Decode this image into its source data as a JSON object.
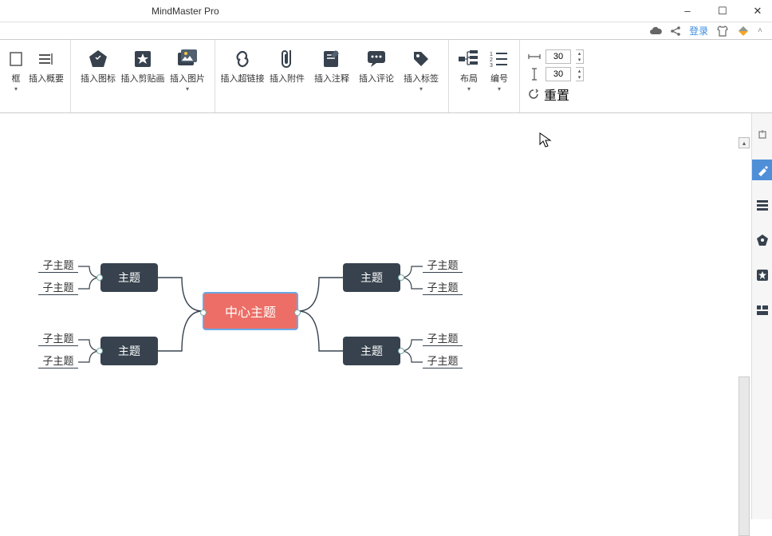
{
  "app_title": "MindMaster Pro",
  "window_controls": {
    "min": "–",
    "max": "☐",
    "close": "✕"
  },
  "secondary_bar": {
    "login_label": "登录",
    "icons": {
      "cloud": "cloud-icon",
      "share": "share-icon",
      "tshirt": "tshirt-icon",
      "collapse": "collapse-icon"
    }
  },
  "ribbon": {
    "group0": [
      {
        "id": "frame",
        "label": "框",
        "has_caret": true
      },
      {
        "id": "summary",
        "label": "插入概要",
        "has_caret": false
      }
    ],
    "group1": [
      {
        "id": "insert-icon",
        "label": "插入图标"
      },
      {
        "id": "insert-clipart",
        "label": "插入剪贴画"
      },
      {
        "id": "insert-image",
        "label": "插入图片",
        "has_caret": true
      }
    ],
    "group2": [
      {
        "id": "insert-hyperlink",
        "label": "插入超链接"
      },
      {
        "id": "insert-attachment",
        "label": "插入附件"
      },
      {
        "id": "insert-note",
        "label": "插入注释"
      },
      {
        "id": "insert-comment",
        "label": "插入评论"
      },
      {
        "id": "insert-tag",
        "label": "插入标签",
        "has_caret": true
      }
    ],
    "group3": [
      {
        "id": "layout",
        "label": "布局",
        "has_caret": true
      },
      {
        "id": "numbering",
        "label": "编号",
        "has_caret": true
      }
    ],
    "spacing": {
      "h": "30",
      "v": "30",
      "reset_label": "重置"
    }
  },
  "mindmap": {
    "center": "中心主题",
    "mains": [
      "主题",
      "主题",
      "主题",
      "主题"
    ],
    "subs": [
      "子主题",
      "子主题",
      "子主题",
      "子主题",
      "子主题",
      "子主题",
      "子主题",
      "子主题"
    ]
  },
  "rightpanel_icons": [
    "pin-icon",
    "brush-icon",
    "list-icon",
    "badge-icon",
    "star-icon",
    "gallery-icon"
  ]
}
